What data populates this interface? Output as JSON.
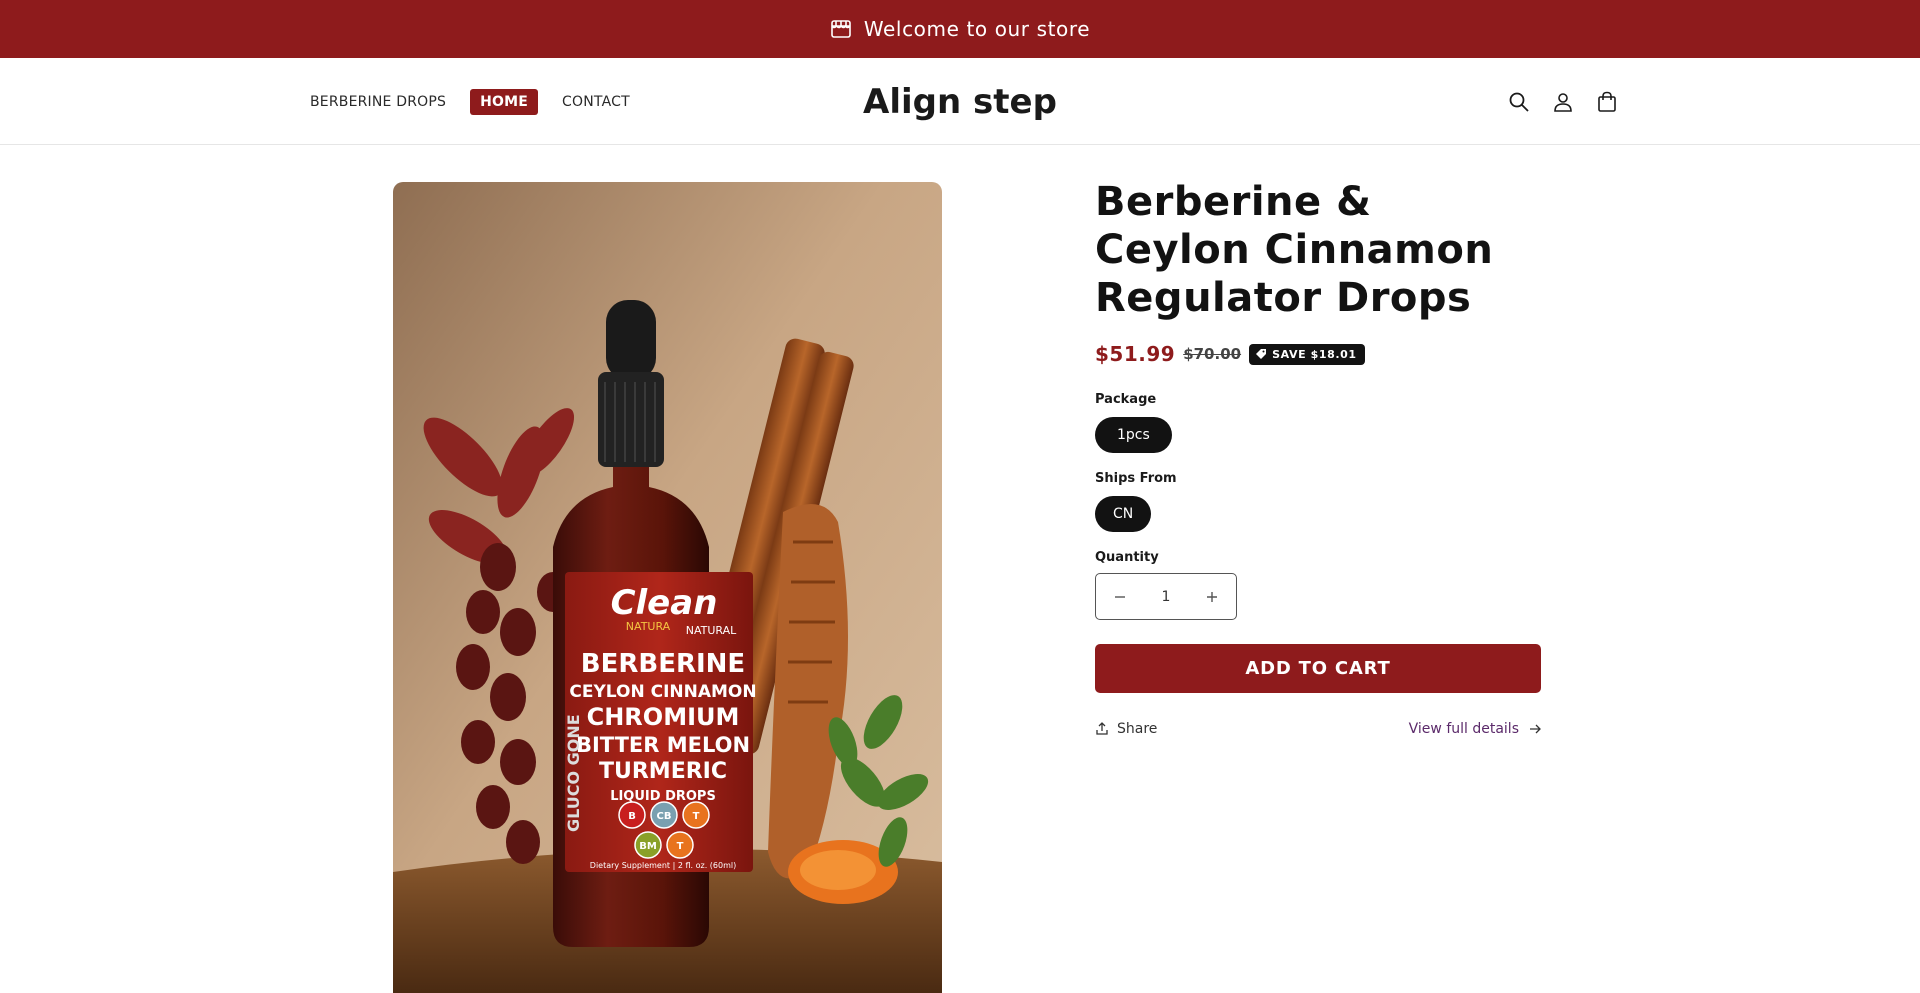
{
  "announcement": {
    "text": "Welcome to our store",
    "icon": "store-icon"
  },
  "header": {
    "logo": "Align step",
    "nav": [
      {
        "label": "BERBERINE DROPS",
        "active": false
      },
      {
        "label": "HOME",
        "active": true
      },
      {
        "label": "CONTACT",
        "active": false
      }
    ],
    "icons": [
      "search-icon",
      "account-icon",
      "cart-icon"
    ]
  },
  "product": {
    "title": "Berberine & Ceylon Cinnamon Regulator Drops",
    "price_sale": "$51.99",
    "price_compare": "$70.00",
    "save_badge": "SAVE $18.01",
    "image_text": {
      "brand": "Clean",
      "brand_sub": "NATURA",
      "brand_natural": "NATURAL",
      "side": "GLUCO GONE",
      "line1": "BERBERINE",
      "line2": "CEYLON CINNAMON",
      "line3": "CHROMIUM",
      "line4": "BITTER MELON",
      "line5": "TURMERIC",
      "line6": "LIQUID DROPS",
      "badges": [
        "B",
        "CB",
        "T",
        "BM",
        "T"
      ],
      "footer": "Dietary Supplement | 2 fl. oz. (60ml)"
    },
    "package": {
      "label": "Package",
      "selected": "1pcs"
    },
    "ships_from": {
      "label": "Ships From",
      "selected": "CN"
    },
    "quantity": {
      "label": "Quantity",
      "value": "1"
    },
    "add_to_cart": "ADD TO CART",
    "share": "Share",
    "view_details": "View full details"
  },
  "colors": {
    "brand": "#8e1b1c",
    "dark": "#121212"
  }
}
